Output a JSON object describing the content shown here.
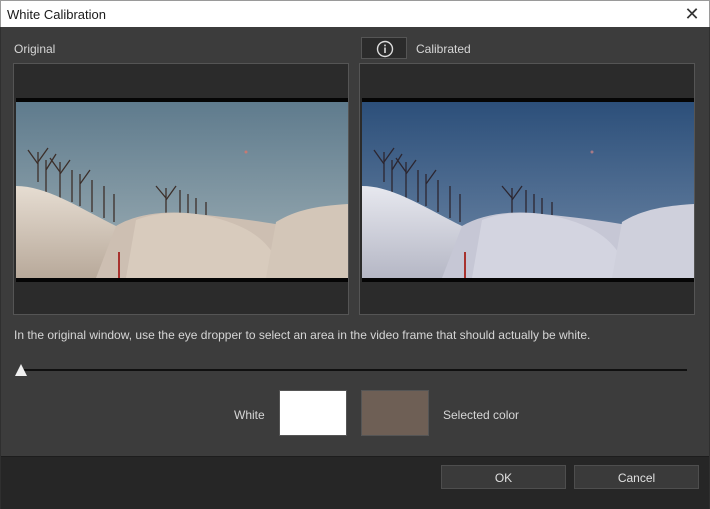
{
  "window": {
    "title": "White Calibration",
    "close_glyph": "✕"
  },
  "panels": {
    "original_label": "Original",
    "calibrated_label": "Calibrated",
    "info_icon": "info-circle-icon"
  },
  "instruction": "In the original window, use the eye dropper to select an area in the video frame that should actually be white.",
  "slider": {
    "value": 0
  },
  "colors": {
    "white_label": "White",
    "selected_label": "Selected color",
    "white_swatch": "#ffffff",
    "selected_swatch": "#6e5f55"
  },
  "buttons": {
    "ok": "OK",
    "cancel": "Cancel"
  }
}
